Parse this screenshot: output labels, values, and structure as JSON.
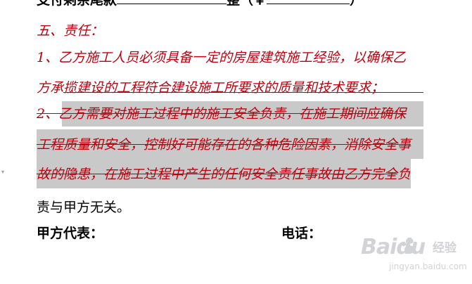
{
  "top_line": {
    "prefix": "支付剩余尾款",
    "middle": "整（￥",
    "suffix": "）"
  },
  "section": {
    "title": "五、责任："
  },
  "item1": {
    "line1": "1、乙方施工人员必须具备一定的房屋建筑施工经验，以确保乙",
    "line2": "方承揽建设的工程符合建设施工所要求的质量和技术要求；"
  },
  "item2": {
    "line1": "2、乙方需要对施工过程中的施工安全负责，在施工期间应确保",
    "line2": "工程质量和安全，控制好可能存在的各种危险因素，消除安全事",
    "line3_main": "故的隐患，在施工过程中产生的任何安全责任事故由乙方完全",
    "line3_tail": "负",
    "line4": "责与甲方无关。"
  },
  "signature": {
    "party_a": "甲方代表：",
    "phone": "电话："
  },
  "watermark": {
    "brand_word": "Baidu",
    "brand_cn": "经验",
    "url": "jingyan.baidu.com"
  },
  "colors": {
    "accent_red": "#c0000c",
    "highlight_gray": "#c9c9c9"
  }
}
